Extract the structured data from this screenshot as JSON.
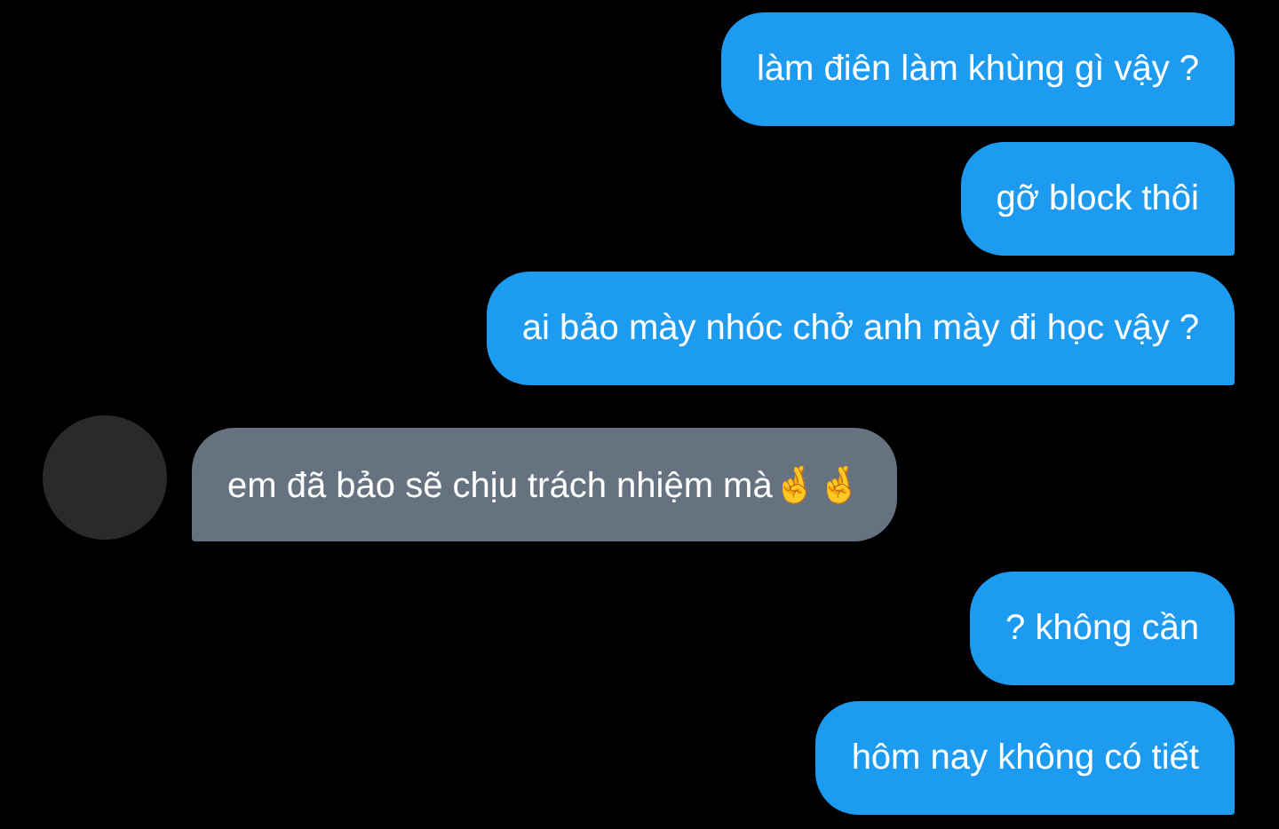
{
  "messages": [
    {
      "kind": "sent",
      "text": "làm điên làm khùng gì vậy ?"
    },
    {
      "kind": "sent",
      "text": "gỡ block thôi"
    },
    {
      "kind": "sent",
      "text": "ai bảo mày nhóc chở anh mày đi học vậy ?"
    },
    {
      "kind": "received",
      "text": "em đã bảo sẽ chịu trách nhiệm mà🤞🤞"
    },
    {
      "kind": "sent",
      "text": "? không cần"
    },
    {
      "kind": "sent",
      "text": "hôm nay không có tiết"
    }
  ]
}
